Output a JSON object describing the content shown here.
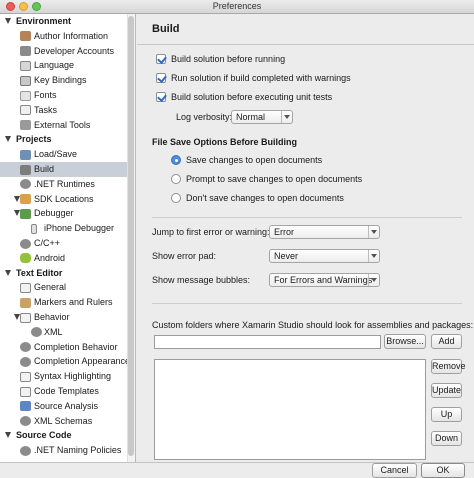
{
  "window": {
    "title": "Preferences"
  },
  "sidebar": {
    "groups": [
      {
        "label": "Environment",
        "items": [
          "Author Information",
          "Developer Accounts",
          "Language",
          "Key Bindings",
          "Fonts",
          "Tasks",
          "External Tools"
        ]
      },
      {
        "label": "Projects",
        "items": [
          "Load/Save",
          "Build",
          ".NET Runtimes",
          "SDK Locations",
          "Debugger",
          "iPhone Debugger",
          "C/C++",
          "Android"
        ]
      },
      {
        "label": "Text Editor",
        "items": [
          "General",
          "Markers and Rulers",
          "Behavior",
          "XML",
          "Completion Behavior",
          "Completion Appearance",
          "Syntax Highlighting",
          "Code Templates",
          "Source Analysis",
          "XML Schemas"
        ]
      },
      {
        "label": "Source Code",
        "items": [
          ".NET Naming Policies"
        ]
      }
    ]
  },
  "build": {
    "title": "Build",
    "options": [
      {
        "label": "Build solution before running",
        "checked": true
      },
      {
        "label": "Run solution if build completed with warnings",
        "checked": true
      },
      {
        "label": "Build solution before executing unit tests",
        "checked": true
      }
    ],
    "log_verbosity_label": "Log verbosity:",
    "log_verbosity_value": "Normal",
    "file_save_heading": "File Save Options Before Building",
    "save_options": [
      {
        "label": "Save changes to open documents",
        "selected": true
      },
      {
        "label": "Prompt to save changes to open documents",
        "selected": false
      },
      {
        "label": "Don't save changes to open documents",
        "selected": false
      }
    ],
    "jump_label": "Jump to first error or warning:",
    "jump_value": "Error",
    "error_pad_label": "Show error pad:",
    "error_pad_value": "Never",
    "bubbles_label": "Show message bubbles:",
    "bubbles_value": "For Errors and Warnings",
    "custom_folders_label": "Custom folders where Xamarin Studio should look for assemblies and packages:",
    "folder_input_value": "",
    "browse_label": "Browse...",
    "add_label": "Add",
    "remove_label": "Remove",
    "update_label": "Update",
    "up_label": "Up",
    "down_label": "Down"
  },
  "footer": {
    "cancel_label": "Cancel",
    "ok_label": "OK"
  },
  "colors": {
    "selection": "#c9cfd8",
    "accent": "#4c8ed9"
  }
}
